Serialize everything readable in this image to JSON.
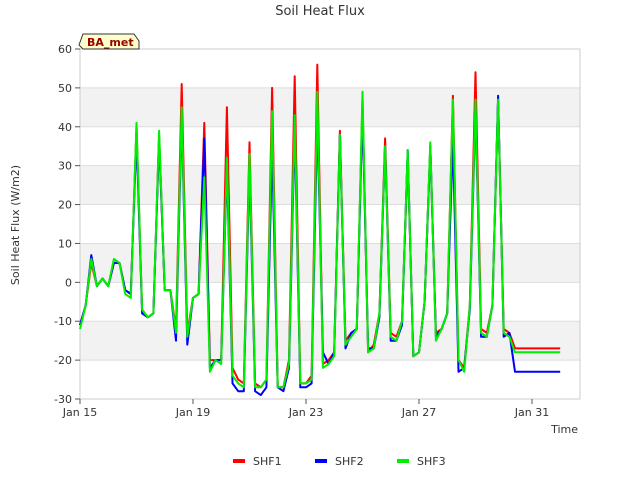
{
  "chart_data": {
    "type": "line",
    "title": "Soil Heat Flux",
    "xlabel": "Time",
    "ylabel": "Soil Heat Flux (W/m2)",
    "badge": "BA_met",
    "xlim": [
      0,
      17.7
    ],
    "ylim": [
      -30,
      60
    ],
    "yticks": [
      -30,
      -20,
      -10,
      0,
      10,
      20,
      30,
      40,
      50,
      60
    ],
    "xticks": [
      {
        "label": "Jan 15",
        "day": 0
      },
      {
        "label": "Jan 19",
        "day": 4
      },
      {
        "label": "Jan 23",
        "day": 8
      },
      {
        "label": "Jan 27",
        "day": 12
      },
      {
        "label": "Jan 31",
        "day": 16
      }
    ],
    "grid": true,
    "legend_position": "bottom",
    "series": [
      {
        "name": "SHF1",
        "color": "#ff0000",
        "x": [
          0.0,
          0.2,
          0.4,
          0.6,
          0.8,
          1.0,
          1.2,
          1.4,
          1.6,
          1.8,
          2.0,
          2.2,
          2.4,
          2.6,
          2.8,
          3.0,
          3.2,
          3.4,
          3.6,
          3.8,
          4.0,
          4.2,
          4.4,
          4.6,
          4.8,
          5.0,
          5.2,
          5.4,
          5.6,
          5.8,
          6.0,
          6.2,
          6.4,
          6.6,
          6.8,
          7.0,
          7.2,
          7.4,
          7.6,
          7.8,
          8.0,
          8.2,
          8.4,
          8.6,
          8.8,
          9.0,
          9.2,
          9.4,
          9.6,
          9.8,
          10.0,
          10.2,
          10.4,
          10.6,
          10.8,
          11.0,
          11.2,
          11.4,
          11.6,
          11.8,
          12.0,
          12.2,
          12.4,
          12.6,
          12.8,
          13.0,
          13.2,
          13.4,
          13.6,
          13.8,
          14.0,
          14.2,
          14.4,
          14.6,
          14.8,
          15.0,
          15.2,
          15.4,
          15.6,
          15.8,
          16.0,
          16.2,
          16.4,
          16.6,
          16.8,
          17.0
        ],
        "y": [
          -11,
          -6,
          5,
          -1,
          1,
          -1,
          5,
          5,
          -2,
          -3,
          40,
          -7,
          -9,
          -8,
          38,
          -2,
          -2,
          -12,
          51,
          -13,
          -4,
          -3,
          41,
          -20,
          -20,
          -20,
          45,
          -22,
          -25,
          -26,
          36,
          -26,
          -27,
          -25,
          50,
          -27,
          -27,
          -20,
          53,
          -26,
          -26,
          -24,
          56,
          -21,
          -20,
          -18,
          39,
          -15,
          -13,
          -12,
          47,
          -18,
          -16,
          -8,
          37,
          -13,
          -14,
          -10,
          33,
          -19,
          -18,
          -5,
          35,
          -13,
          -12,
          -8,
          48,
          -20,
          -22,
          -6,
          54,
          -12,
          -13,
          -6,
          47,
          -12,
          -13,
          -17,
          -17,
          -17,
          -17,
          -17,
          -17,
          -17,
          -17,
          -17
        ]
      },
      {
        "name": "SHF2",
        "color": "#0000ff",
        "x": [
          0.0,
          0.2,
          0.4,
          0.6,
          0.8,
          1.0,
          1.2,
          1.4,
          1.6,
          1.8,
          2.0,
          2.2,
          2.4,
          2.6,
          2.8,
          3.0,
          3.2,
          3.4,
          3.6,
          3.8,
          4.0,
          4.2,
          4.4,
          4.6,
          4.8,
          5.0,
          5.2,
          5.4,
          5.6,
          5.8,
          6.0,
          6.2,
          6.4,
          6.6,
          6.8,
          7.0,
          7.2,
          7.4,
          7.6,
          7.8,
          8.0,
          8.2,
          8.4,
          8.6,
          8.8,
          9.0,
          9.2,
          9.4,
          9.6,
          9.8,
          10.0,
          10.2,
          10.4,
          10.6,
          10.8,
          11.0,
          11.2,
          11.4,
          11.6,
          11.8,
          12.0,
          12.2,
          12.4,
          12.6,
          12.8,
          13.0,
          13.2,
          13.4,
          13.6,
          13.8,
          14.0,
          14.2,
          14.4,
          14.6,
          14.8,
          15.0,
          15.2,
          15.4,
          15.6,
          15.8,
          16.0,
          16.2,
          16.4,
          16.6,
          16.8,
          17.0
        ],
        "y": [
          -11,
          -6,
          7,
          -1,
          1,
          -1,
          5,
          5,
          -2,
          -3,
          38,
          -8,
          -9,
          -8,
          37,
          -2,
          -2,
          -15,
          43,
          -16,
          -4,
          -3,
          37,
          -22,
          -20,
          -20,
          30,
          -26,
          -28,
          -28,
          30,
          -28,
          -29,
          -27,
          35,
          -27,
          -28,
          -22,
          40,
          -27,
          -27,
          -26,
          43,
          -18,
          -21,
          -18,
          38,
          -17,
          -13,
          -12,
          45,
          -17,
          -17,
          -9,
          35,
          -15,
          -15,
          -11,
          34,
          -19,
          -18,
          -5,
          35,
          -14,
          -12,
          -8,
          37,
          -23,
          -22,
          -7,
          45,
          -14,
          -14,
          -6,
          48,
          -14,
          -13,
          -23,
          -23,
          -23,
          -23,
          -23,
          -23,
          -23,
          -23,
          -23
        ]
      },
      {
        "name": "SHF3",
        "color": "#00ee00",
        "x": [
          0.0,
          0.2,
          0.4,
          0.6,
          0.8,
          1.0,
          1.2,
          1.4,
          1.6,
          1.8,
          2.0,
          2.2,
          2.4,
          2.6,
          2.8,
          3.0,
          3.2,
          3.4,
          3.6,
          3.8,
          4.0,
          4.2,
          4.4,
          4.6,
          4.8,
          5.0,
          5.2,
          5.4,
          5.6,
          5.8,
          6.0,
          6.2,
          6.4,
          6.6,
          6.8,
          7.0,
          7.2,
          7.4,
          7.6,
          7.8,
          8.0,
          8.2,
          8.4,
          8.6,
          8.8,
          9.0,
          9.2,
          9.4,
          9.6,
          9.8,
          10.0,
          10.2,
          10.4,
          10.6,
          10.8,
          11.0,
          11.2,
          11.4,
          11.6,
          11.8,
          12.0,
          12.2,
          12.4,
          12.6,
          12.8,
          13.0,
          13.2,
          13.4,
          13.6,
          13.8,
          14.0,
          14.2,
          14.4,
          14.6,
          14.8,
          15.0,
          15.2,
          15.4,
          15.6,
          15.8,
          16.0,
          16.2,
          16.4,
          16.6,
          16.8,
          17.0
        ],
        "y": [
          -12,
          -6,
          6,
          -1,
          1,
          -1,
          6,
          5,
          -3,
          -4,
          41,
          -7,
          -9,
          -8,
          39,
          -2,
          -2,
          -13,
          45,
          -14,
          -4,
          -3,
          27,
          -23,
          -20,
          -21,
          32,
          -24,
          -26,
          -27,
          33,
          -27,
          -27,
          -25,
          44,
          -27,
          -27,
          -21,
          43,
          -26,
          -26,
          -25,
          49,
          -22,
          -21,
          -19,
          38,
          -16,
          -14,
          -12,
          49,
          -18,
          -17,
          -8,
          35,
          -14,
          -15,
          -10,
          34,
          -19,
          -18,
          -5,
          36,
          -15,
          -12,
          -8,
          47,
          -20,
          -23,
          -6,
          47,
          -13,
          -14,
          -6,
          47,
          -13,
          -14,
          -18,
          -18,
          -18,
          -18,
          -18,
          -18,
          -18,
          -18,
          -18
        ]
      }
    ]
  }
}
